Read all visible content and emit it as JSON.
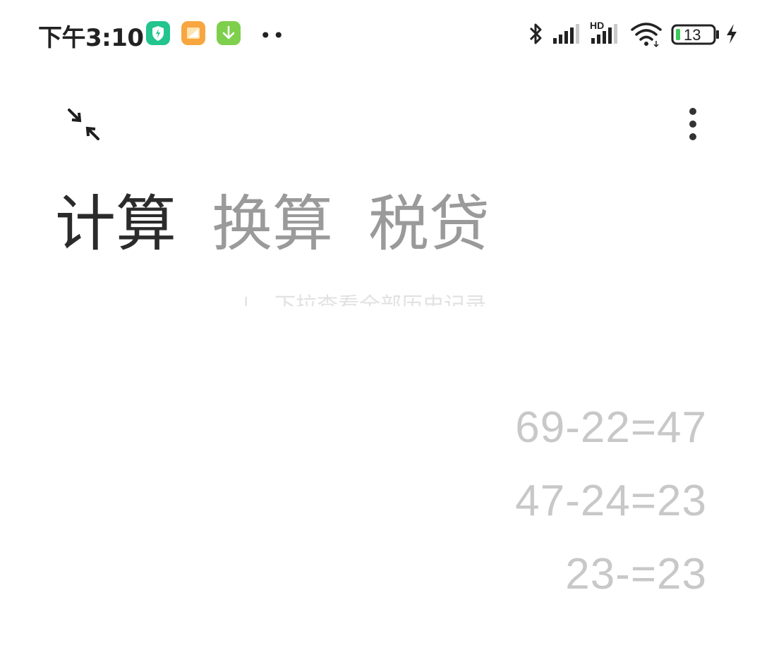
{
  "status_bar": {
    "time": "下午3:10",
    "apps": [
      {
        "name": "security-app-icon",
        "color": "#23c48e"
      },
      {
        "name": "gallery-app-icon",
        "color": "#f7a640"
      },
      {
        "name": "download-app-icon",
        "color": "#7ecf4b"
      }
    ],
    "more_dots": "••",
    "network_hd": "HD",
    "battery_level": "13"
  },
  "toolbar": {
    "collapse_icon": "collapse-arrows-icon",
    "more_icon": "more-vertical-icon"
  },
  "tabs": [
    {
      "label": "计算",
      "active": true
    },
    {
      "label": "换算",
      "active": false
    },
    {
      "label": "税贷",
      "active": false
    }
  ],
  "pull_hint": "下拉查看全部历史记录",
  "history": [
    "69-22=47",
    "47-24=23",
    "23-=23"
  ]
}
